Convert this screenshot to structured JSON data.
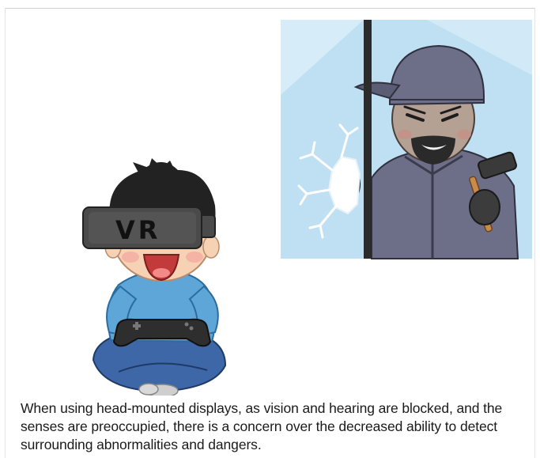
{
  "illustration": {
    "headset_label": "VR",
    "colors": {
      "window_glass": "#bfe0f2",
      "window_frame": "#2b2b2b",
      "intruder_clothes": "#6d6f88",
      "intruder_skin": "#b4a193",
      "boy_shirt": "#5ea6d8",
      "boy_pants": "#3d67a6",
      "boy_skin": "#f7d1b3",
      "headset": "#4a4a4a",
      "hair": "#222222"
    }
  },
  "caption": {
    "text": "When using head-mounted displays, as vision and hearing are blocked, and the senses are preoccupied, there is a concern over the decreased ability to detect surrounding abnormalities and dangers."
  }
}
